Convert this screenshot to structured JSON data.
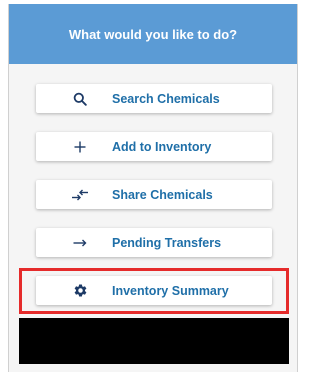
{
  "header": {
    "title": "What would you like to do?"
  },
  "menu": {
    "items": [
      {
        "label": "Search Chemicals",
        "icon": "search-icon"
      },
      {
        "label": "Add to Inventory",
        "icon": "plus-icon"
      },
      {
        "label": "Share Chemicals",
        "icon": "swap-arrows-icon"
      },
      {
        "label": "Pending Transfers",
        "icon": "arrow-right-icon"
      },
      {
        "label": "Inventory Summary",
        "icon": "gear-icon"
      }
    ]
  },
  "colors": {
    "header_bg": "#5b9bd5",
    "label_text": "#1f6fa8",
    "icon": "#1d3a66",
    "highlight": "#e52b2b"
  }
}
